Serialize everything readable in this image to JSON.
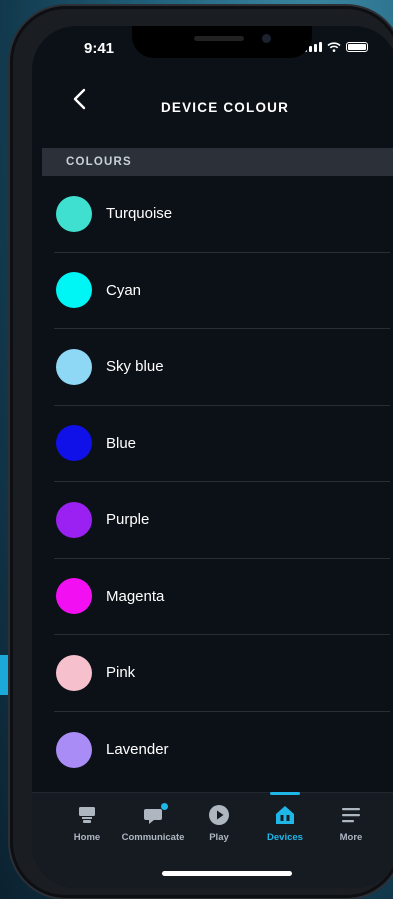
{
  "status_bar": {
    "time": "9:41"
  },
  "header": {
    "title": "DEVICE COLOUR"
  },
  "section": {
    "title": "COLOURS"
  },
  "colors": [
    {
      "label": "Turquoise",
      "hex": "#40e0d0"
    },
    {
      "label": "Cyan",
      "hex": "#00f5f5"
    },
    {
      "label": "Sky blue",
      "hex": "#8fd8f5"
    },
    {
      "label": "Blue",
      "hex": "#1010e8"
    },
    {
      "label": "Purple",
      "hex": "#9b20f2"
    },
    {
      "label": "Magenta",
      "hex": "#f210f2"
    },
    {
      "label": "Pink",
      "hex": "#f6c0cc"
    },
    {
      "label": "Lavender",
      "hex": "#a98cf5"
    }
  ],
  "bottom_nav": [
    {
      "label": "Home",
      "icon": "home-icon"
    },
    {
      "label": "Communicate",
      "icon": "chat-bubble-icon"
    },
    {
      "label": "Play",
      "icon": "play-icon"
    },
    {
      "label": "Devices",
      "icon": "devices-house-icon",
      "active": true
    },
    {
      "label": "More",
      "icon": "menu-lines-icon"
    }
  ],
  "accent_color": "#1fb6e8"
}
